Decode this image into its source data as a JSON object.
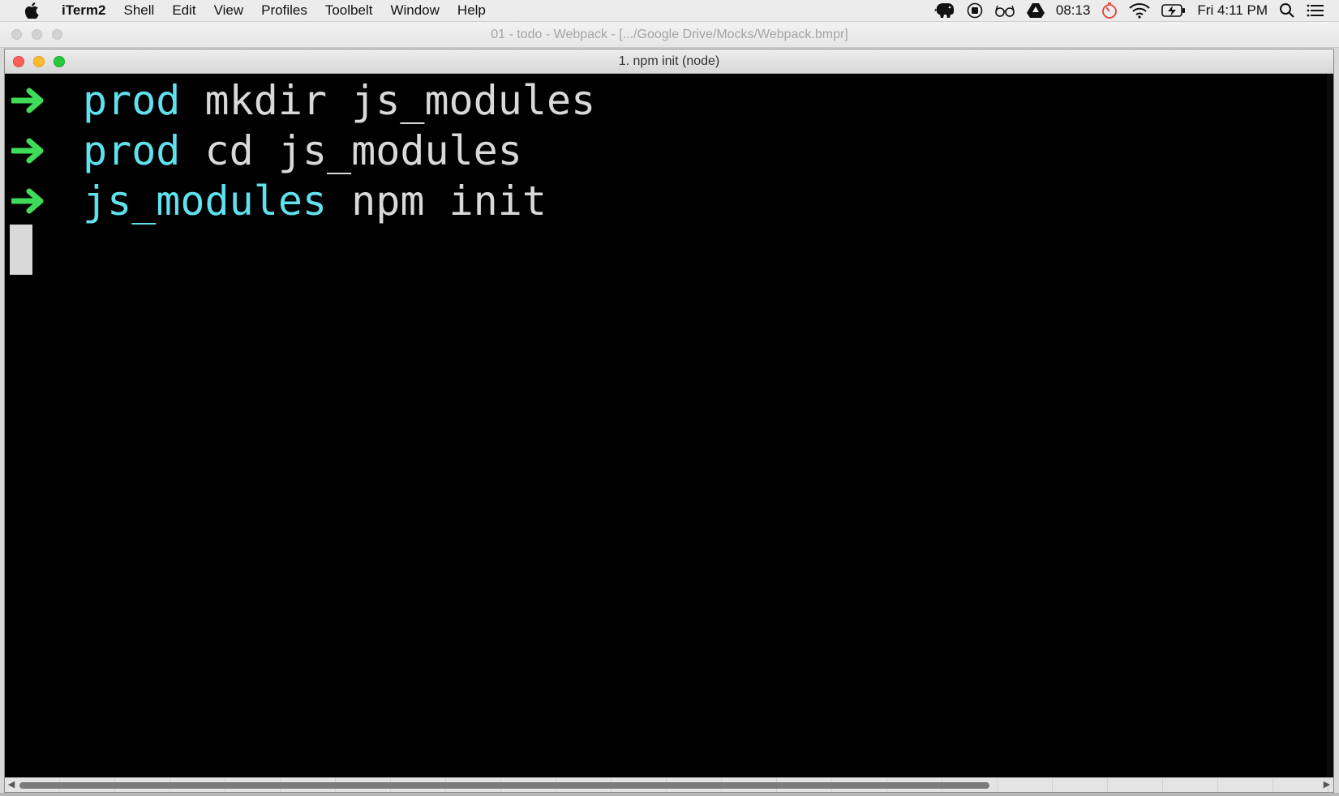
{
  "menubar": {
    "apple_icon": "apple-logo",
    "app_name": "iTerm2",
    "items": [
      "Shell",
      "Edit",
      "View",
      "Profiles",
      "Toolbelt",
      "Window",
      "Help"
    ],
    "status": {
      "clock_timer": "08:13",
      "datetime": "Fri 4:11 PM"
    },
    "status_icons": [
      "evernote-elephant-icon",
      "record-icon",
      "glasses-icon",
      "drive-icon",
      "timer-icon",
      "wifi-icon",
      "battery-charging-icon",
      "search-icon",
      "list-icon"
    ]
  },
  "outer_window": {
    "title": "01 - todo - Webpack - [.../Google Drive/Mocks/Webpack.bmpr]"
  },
  "terminal_window": {
    "title": "1. npm init (node)",
    "lines": [
      {
        "prompt_dir": "prod",
        "command": "mkdir js_modules"
      },
      {
        "prompt_dir": "prod",
        "command": "cd js_modules"
      },
      {
        "prompt_dir": "js_modules",
        "command": "npm init"
      }
    ],
    "colors": {
      "arrow": "#3fdc5a",
      "prompt_dir": "#5fe1ee",
      "command": "#d9d9d9",
      "background": "#000000"
    }
  }
}
